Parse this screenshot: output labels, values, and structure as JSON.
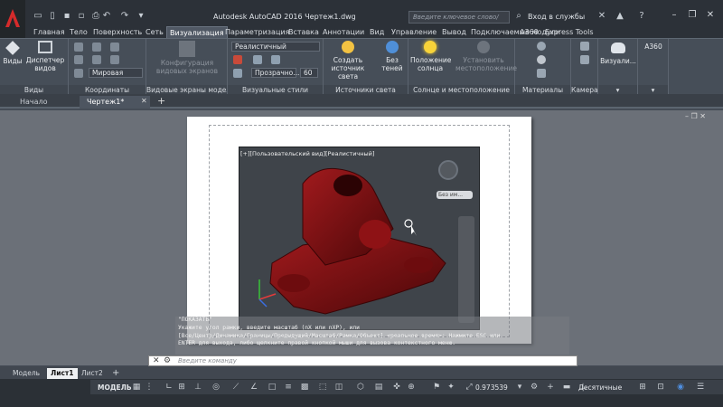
{
  "title": "Autodesk AutoCAD 2016   Чертеж1.dwg",
  "search_placeholder": "Введите ключевое слово/фразу",
  "signin": "Вход в службы",
  "ribbon_tabs": [
    "Главная",
    "Тело",
    "Поверхность",
    "Сеть",
    "Визуализация",
    "Параметризация",
    "Вставка",
    "Аннотации",
    "Вид",
    "Управление",
    "Вывод",
    "Подключаемые модули",
    "A360",
    "Express Tools"
  ],
  "active_tab": "Визуализация",
  "groups": {
    "views": {
      "label": "Виды",
      "btn_views": "Виды",
      "btn_dispatcher": "Диспетчер видов"
    },
    "coords": {
      "label": "Координаты",
      "world": "Мировая"
    },
    "viewports": {
      "label": "Видовые экраны модели",
      "btn": "Конфигурация видовых экранов"
    },
    "visual_styles": {
      "label": "Визуальные стили",
      "style": "Реалистичный",
      "opacity_label": "Прозрачно...",
      "opacity_value": "60"
    },
    "lights": {
      "label": "Источники света",
      "create": "Создать источник света",
      "no_shadows": "Без теней"
    },
    "sun": {
      "label": "Солнце и местоположение",
      "sun_pos": "Положение солнца",
      "set_loc": "Установить местоположение"
    },
    "materials": {
      "label": "Материалы"
    },
    "camera": {
      "label": "Камера"
    },
    "render": {
      "label": "Визуали...",
      "a360": "A360"
    }
  },
  "doc_tabs": [
    "Начало",
    "Чертеж1*"
  ],
  "viewport_label": "[+][Пользовательский вид][Реалистичный]",
  "viewcube_label": "Без им...",
  "command_lines": [
    "\"ПОКАЗАТЬ\"",
    "Укажите угол рамки, введите масштаб (nX или nXP), или",
    "[Все/Центр/Динамика/Границы/Предыдущий/Масштаб/Рамка/Объект] <реальное время>:  Нажмите ESC или",
    "ENTER для выхода, либо щелкните правой кнопкой мыши для вызова контекстного меню."
  ],
  "command_placeholder": "Введите команду",
  "layout_tabs": [
    "Модель",
    "Лист1",
    "Лист2"
  ],
  "active_layout": "Лист1",
  "status": {
    "model": "МОДЕЛЬ",
    "scale": "0.973539",
    "units": "Десятичные"
  },
  "colors": {
    "model_color": "#7a0d10",
    "accent": "#2b6bd1"
  }
}
